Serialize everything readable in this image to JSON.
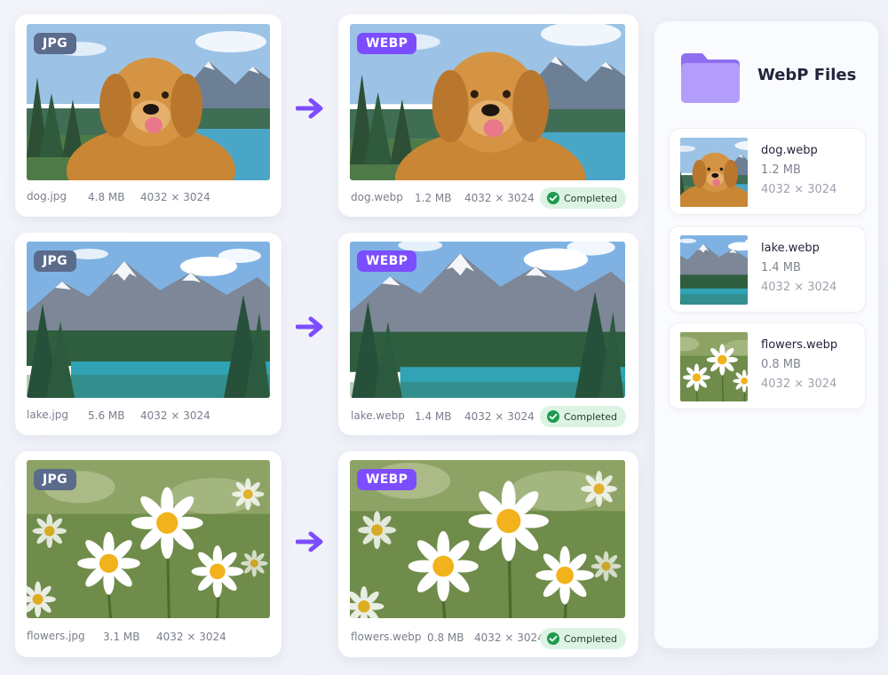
{
  "badges": {
    "jpg": "JPG",
    "webp": "WEBP"
  },
  "status_label": "Completed",
  "rows": [
    {
      "source": {
        "name": "dog.jpg",
        "size": "4.8 MB",
        "dims": "4032 × 3024"
      },
      "output": {
        "name": "dog.webp",
        "size": "1.2 MB",
        "dims": "4032 × 3024"
      }
    },
    {
      "source": {
        "name": "lake.jpg",
        "size": "5.6 MB",
        "dims": "4032 × 3024"
      },
      "output": {
        "name": "lake.webp",
        "size": "1.4 MB",
        "dims": "4032 × 3024"
      }
    },
    {
      "source": {
        "name": "flowers.jpg",
        "size": "3.1 MB",
        "dims": "4032 × 3024"
      },
      "output": {
        "name": "flowers.webp",
        "size": "0.8 MB",
        "dims": "4032 × 3024"
      }
    }
  ],
  "side_panel": {
    "title": "WebP Files",
    "files": [
      {
        "name": "dog.webp",
        "size": "1.2 MB",
        "dims": "4032 × 3024"
      },
      {
        "name": "lake.webp",
        "size": "1.4 MB",
        "dims": "4032 × 3024"
      },
      {
        "name": "flowers.webp",
        "size": "0.8 MB",
        "dims": "4032 × 3024"
      }
    ]
  },
  "colors": {
    "accent": "#7c4dff",
    "jpg_badge": "#5b6b8c",
    "status_bg": "#dcf3e4",
    "status_check": "#1e9a4f"
  },
  "icons": {
    "arrow": "arrow-right-icon",
    "folder": "folder-icon",
    "check": "check-circle-icon"
  }
}
